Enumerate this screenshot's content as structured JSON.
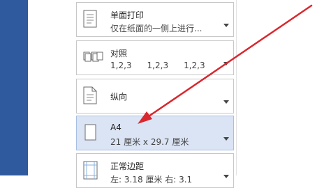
{
  "colors": {
    "ribbon": "#2f5a9e",
    "selected_bg": "#dbe4f4",
    "arrow": "#d9272e"
  },
  "print_settings": {
    "sides": {
      "title": "单面打印",
      "desc": "仅在纸面的一侧上进行...",
      "icon": "single-page-icon"
    },
    "collate": {
      "title": "对照",
      "desc_parts": [
        "1,2,3",
        "1,2,3",
        "1,2,3"
      ],
      "icon": "collated-pages-icon"
    },
    "orientation": {
      "title": "纵向",
      "icon": "portrait-page-icon"
    },
    "paper_size": {
      "title": "A4",
      "desc": "21 厘米 x 29.7 厘米",
      "icon": "paper-size-icon",
      "selected": true
    },
    "margins": {
      "title": "正常边距",
      "desc": "左: 3.18 厘米  右: 3.1",
      "icon": "margins-icon"
    }
  },
  "annotation": {
    "type": "arrow",
    "icon": "red-arrow-annotation"
  }
}
